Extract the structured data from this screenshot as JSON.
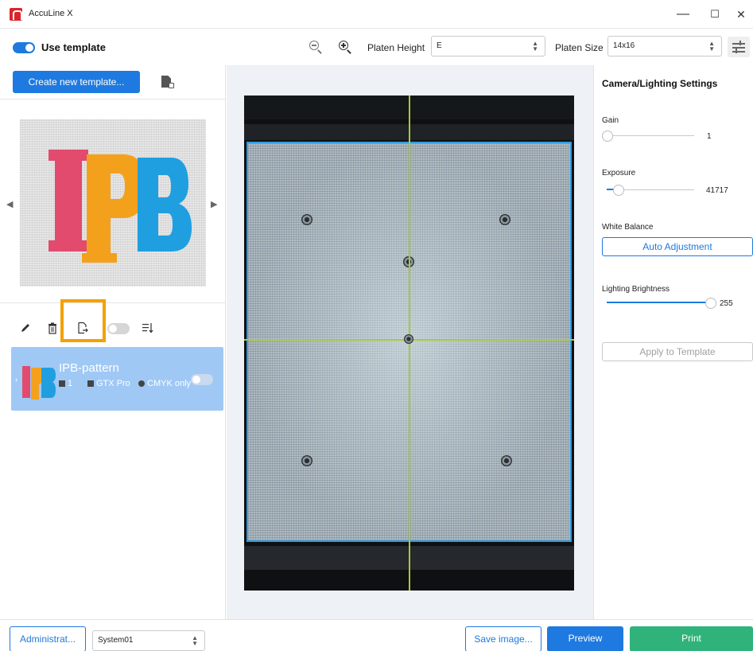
{
  "window": {
    "title": "AccuLine X",
    "minimize": "—",
    "maximize": "☐",
    "close": "✕"
  },
  "toolbar": {
    "use_template_label": "Use template",
    "use_template_on": true,
    "platen_height_label": "Platen Height",
    "platen_height_value": "E",
    "platen_size_label": "Platen Size",
    "platen_size_value": "14x16"
  },
  "left": {
    "create_button": "Create new template...",
    "template_preview_text": "IPB",
    "template": {
      "name": "IPB-pattern",
      "count": "1",
      "printer": "GTX Pro",
      "mode": "CMYK only"
    }
  },
  "right": {
    "title": "Camera/Lighting Settings",
    "gain_label": "Gain",
    "gain_value": "1",
    "exposure_label": "Exposure",
    "exposure_value": "41717",
    "white_balance_label": "White Balance",
    "auto_adjust_button": "Auto Adjustment",
    "lighting_label": "Lighting Brightness",
    "lighting_value": "255",
    "apply_button": "Apply to Template"
  },
  "bottom": {
    "admin_button": "Administrat...",
    "system_value": "System01",
    "save_button": "Save image...",
    "preview_button": "Preview",
    "print_button": "Print"
  },
  "colors": {
    "accent": "#1e7ae0",
    "print_green": "#2fb37a",
    "highlight": "#f4a100",
    "crosshair": "#a8c93a",
    "platen_outline": "#2f9be0"
  }
}
